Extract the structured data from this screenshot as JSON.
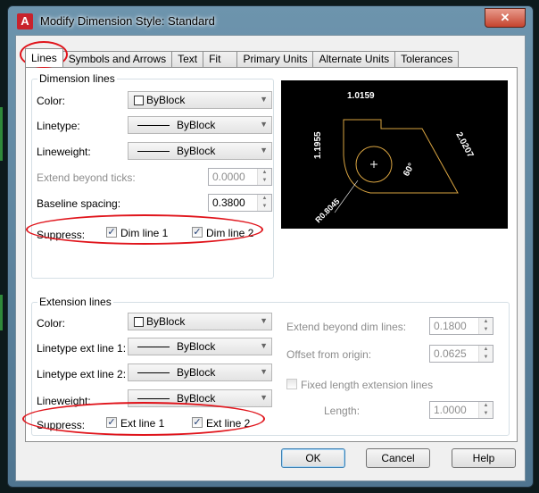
{
  "window": {
    "title": "Modify Dimension Style: Standard",
    "close_glyph": "✕",
    "app_icon": "A"
  },
  "tabs": [
    {
      "label": "Lines",
      "active": true
    },
    {
      "label": "Symbols and Arrows"
    },
    {
      "label": "Text"
    },
    {
      "label": "Fit"
    },
    {
      "label": "Primary Units"
    },
    {
      "label": "Alternate Units"
    },
    {
      "label": "Tolerances"
    }
  ],
  "dimension_lines": {
    "title": "Dimension lines",
    "color": {
      "label": "Color:",
      "value": "ByBlock"
    },
    "linetype": {
      "label": "Linetype:",
      "value": "ByBlock"
    },
    "lineweight": {
      "label": "Lineweight:",
      "value": "ByBlock"
    },
    "extend_beyond_ticks": {
      "label": "Extend beyond ticks:",
      "value": "0.0000"
    },
    "baseline_spacing": {
      "label": "Baseline spacing:",
      "value": "0.3800"
    },
    "suppress": {
      "label": "Suppress:",
      "line1": "Dim line 1",
      "line2": "Dim line 2",
      "line1_checked": true,
      "line2_checked": true
    }
  },
  "extension_lines": {
    "title": "Extension lines",
    "color": {
      "label": "Color:",
      "value": "ByBlock"
    },
    "linetype1": {
      "label": "Linetype ext line 1:",
      "value": "ByBlock"
    },
    "linetype2": {
      "label": "Linetype ext line 2:",
      "value": "ByBlock"
    },
    "lineweight": {
      "label": "Lineweight:",
      "value": "ByBlock"
    },
    "suppress": {
      "label": "Suppress:",
      "line1": "Ext line 1",
      "line2": "Ext line 2",
      "line1_checked": true,
      "line2_checked": true
    },
    "extend_beyond": {
      "label": "Extend beyond dim lines:",
      "value": "0.1800"
    },
    "offset": {
      "label": "Offset from origin:",
      "value": "0.0625"
    },
    "fixed_length": {
      "label": "Fixed length extension lines",
      "checked": false
    },
    "length": {
      "label": "Length:",
      "value": "1.0000"
    }
  },
  "preview": {
    "top": "1.0159",
    "left": "1.1955",
    "right": "2.0207",
    "angle": "60°",
    "radius": "R0.8045",
    "shape_color": "#d9a441"
  },
  "buttons": {
    "ok": "OK",
    "cancel": "Cancel",
    "help": "Help"
  },
  "annotation_color": "#e0141b"
}
